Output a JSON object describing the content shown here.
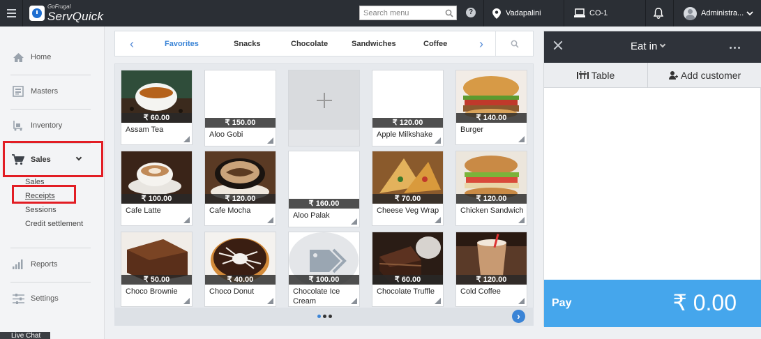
{
  "topbar": {
    "logo_small": "GoFrugal",
    "logo_big": "ServQuick",
    "search_placeholder": "Search menu",
    "location": "Vadapalini",
    "counter": "CO-1",
    "user": "Administra..."
  },
  "sidebar": {
    "items": [
      {
        "label": "Home",
        "icon": "home-icon"
      },
      {
        "label": "Masters",
        "icon": "masters-icon"
      },
      {
        "label": "Inventory",
        "icon": "inventory-icon"
      },
      {
        "label": "Sales",
        "icon": "cart-icon"
      },
      {
        "label": "Reports",
        "icon": "reports-icon"
      },
      {
        "label": "Settings",
        "icon": "settings-icon"
      }
    ],
    "sales_sub": [
      "Sales",
      "Receipts",
      "Sessions",
      "Credit settlement"
    ],
    "live_chat": "Live Chat"
  },
  "categories": {
    "tabs": [
      "Favorites",
      "Snacks",
      "Chocolate",
      "Sandwiches",
      "Coffee"
    ],
    "active": "Favorites"
  },
  "products": [
    {
      "name": "Assam Tea",
      "price": "₹ 60.00",
      "image": "tea"
    },
    {
      "name": "Aloo Gobi",
      "price": "₹ 150.00",
      "image": "none"
    },
    {
      "name": "",
      "price": "",
      "image": "add"
    },
    {
      "name": "Apple Milkshake",
      "price": "₹ 120.00",
      "image": "none"
    },
    {
      "name": "Burger",
      "price": "₹ 140.00",
      "image": "burger"
    },
    {
      "name": "Cafe Latte",
      "price": "₹ 100.00",
      "image": "latte"
    },
    {
      "name": "Cafe Mocha",
      "price": "₹ 120.00",
      "image": "mocha"
    },
    {
      "name": "Aloo Palak",
      "price": "₹ 160.00",
      "image": "none"
    },
    {
      "name": "Cheese Veg Wrap",
      "price": "₹ 70.00",
      "image": "wrap"
    },
    {
      "name": "Chicken Sandwich",
      "price": "₹ 120.00",
      "image": "sandwich"
    },
    {
      "name": "Choco Brownie",
      "price": "₹ 50.00",
      "image": "brownie"
    },
    {
      "name": "Choco Donut",
      "price": "₹ 40.00",
      "image": "donut"
    },
    {
      "name": "Chocolate Ice Cream",
      "price": "₹ 100.00",
      "image": "tag"
    },
    {
      "name": "Chocolate Truffle",
      "price": "₹ 60.00",
      "image": "truffle"
    },
    {
      "name": "Cold Coffee",
      "price": "₹ 120.00",
      "image": "coldcoffee"
    }
  ],
  "order": {
    "mode": "Eat in",
    "table_label": "Table",
    "add_customer_label": "Add customer",
    "pay_label": "Pay",
    "total": "₹ 0.00"
  },
  "colors": {
    "accent": "#3a84d6",
    "pay": "#45a6ec",
    "topbar": "#2b2f35",
    "highlight": "#e21d24"
  }
}
